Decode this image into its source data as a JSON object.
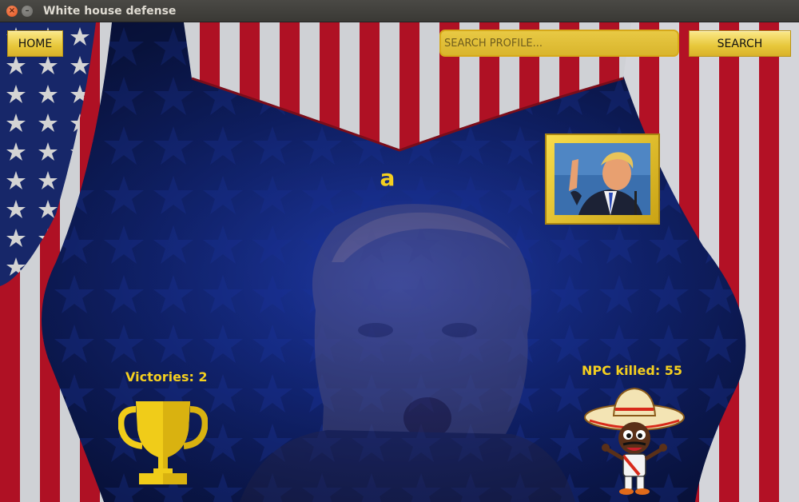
{
  "window": {
    "title": "White house defense",
    "close_glyph": "×",
    "minimize_glyph": "–"
  },
  "toolbar": {
    "home_label": "HOME",
    "search_placeholder": "SEARCH PROFILE...",
    "search_value": "",
    "search_label": "SEARCH"
  },
  "profile": {
    "player_name": "a",
    "avatar_icon": "president-portrait-icon"
  },
  "stats": {
    "victories_text": "Victories: 2",
    "npc_killed_text": "NPC killed: 55"
  },
  "icons": {
    "trophy": "trophy-icon",
    "npc": "sombrero-character-icon"
  },
  "colors": {
    "accent_gold": "#f4cf1f",
    "button_gold": "#e7c73a",
    "stage_blue": "#142a86",
    "curtain_red": "#c8142a",
    "curtain_white": "#eef0f4"
  }
}
